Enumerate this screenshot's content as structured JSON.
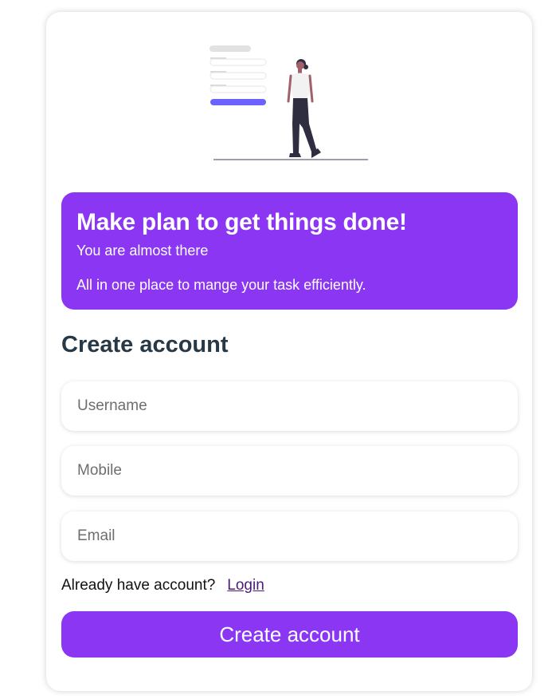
{
  "banner": {
    "title": "Make plan to get things done!",
    "subtitle": "You are almost there",
    "description": "All in one place to mange your task efficiently."
  },
  "form": {
    "heading": "Create account",
    "username_placeholder": "Username",
    "mobile_placeholder": "Mobile",
    "email_placeholder": "Email",
    "login_prompt": "Already have account?",
    "login_link": "Login",
    "submit_label": "Create account"
  },
  "colors": {
    "accent": "#8a36f3",
    "heading": "#273846",
    "illustration_accent": "#6c63ff"
  },
  "icons": {
    "illustration": "person-with-form-illustration"
  }
}
